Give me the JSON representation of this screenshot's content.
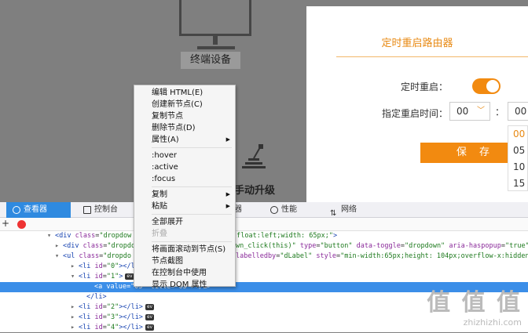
{
  "background": {
    "device_label": "终端设备",
    "upgrade_label": "手动升级"
  },
  "panel": {
    "title": "定时重启路由器",
    "reboot_label": "定时重启：",
    "time_label": "指定重启时间：",
    "hour_value": "00",
    "minute_value": "00",
    "colon": "：",
    "dropdown_options": [
      "00",
      "05",
      "10",
      "15"
    ],
    "save_label": "保 存",
    "accent_color": "#f28a10"
  },
  "context_menu": {
    "groups": [
      [
        {
          "label": "编辑 HTML(E)",
          "submenu": false,
          "disabled": false
        },
        {
          "label": "创建新节点(C)",
          "submenu": false,
          "disabled": false
        },
        {
          "label": "复制节点",
          "submenu": false,
          "disabled": false
        },
        {
          "label": "删除节点(D)",
          "submenu": false,
          "disabled": false
        },
        {
          "label": "属性(A)",
          "submenu": true,
          "disabled": false
        }
      ],
      [
        {
          "label": ":hover",
          "submenu": false,
          "disabled": false
        },
        {
          "label": ":active",
          "submenu": false,
          "disabled": false
        },
        {
          "label": ":focus",
          "submenu": false,
          "disabled": false
        }
      ],
      [
        {
          "label": "复制",
          "submenu": true,
          "disabled": false
        },
        {
          "label": "粘贴",
          "submenu": true,
          "disabled": false
        }
      ],
      [
        {
          "label": "全部展开",
          "submenu": false,
          "disabled": false
        },
        {
          "label": "折叠",
          "submenu": false,
          "disabled": true
        }
      ],
      [
        {
          "label": "将画面滚动到节点(S)",
          "submenu": false,
          "disabled": false
        },
        {
          "label": "节点截图",
          "submenu": false,
          "disabled": false
        },
        {
          "label": "在控制台中使用",
          "submenu": false,
          "disabled": false
        },
        {
          "label": "显示 DOM 属性",
          "submenu": false,
          "disabled": false
        }
      ]
    ]
  },
  "devtools": {
    "tabs": [
      {
        "label": "查看器",
        "active": true
      },
      {
        "label": "控制台",
        "active": false
      },
      {
        "label": "器",
        "active": false
      },
      {
        "label": "性能",
        "active": false
      },
      {
        "label": "网络",
        "active": false
      }
    ],
    "toolbar_plus": "+",
    "code_lines": [
      {
        "indent": 6,
        "tri": "▾",
        "html": "<span class=\"tag\">&lt;div</span> <span class=\"attr\">class</span>=<span class=\"val\">\"dropdow</span>",
        "tail": "<span class=\"val\">\"float:left;width: 65px;\"</span><span class=\"tag\">&gt;</span>",
        "tail_at": 296,
        "ev": false,
        "hl": false
      },
      {
        "indent": 7,
        "tri": "▸",
        "html": "<span class=\"tag\">&lt;div</span> <span class=\"attr\">class</span>=<span class=\"val\">\"dropdo</span>",
        "tail": "<span class=\"val\">wn_click(this)\"</span> <span class=\"attr\">type</span>=<span class=\"val\">\"button\"</span> <span class=\"attr\">data-toggle</span>=<span class=\"val\">\"dropdown\"</span> <span class=\"attr\">aria-haspopup</span>=<span class=\"val\">\"true\"</span> <span class=\"attr\">a</span>",
        "tail_at": 300,
        "ev": false,
        "hl": false
      },
      {
        "indent": 7,
        "tri": "▾",
        "html": "<span class=\"tag\">&lt;ul</span> <span class=\"attr\">class</span>=<span class=\"val\">\"dropdo</span>",
        "tail": "<span class=\"attr\">labelledby</span>=<span class=\"val\">\"dLabel\"</span> <span class=\"attr\">style</span>=<span class=\"val\">\"min-width:65px;height: 104px;overflow-x:hidden\"</span><span class=\"tag\">&gt;</span>",
        "tail_at": 300,
        "ev": false,
        "hl": false
      },
      {
        "indent": 9,
        "tri": "▸",
        "html": "<span class=\"tag\">&lt;li</span> <span class=\"attr\">id</span>=<span class=\"val\">\"0\"</span><span class=\"tag\">&gt;&lt;/li&gt;</span>",
        "tail": "",
        "tail_at": 0,
        "ev": true,
        "hl": false
      },
      {
        "indent": 9,
        "tri": "▾",
        "html": "<span class=\"tag\">&lt;li</span> <span class=\"attr\">id</span>=<span class=\"val\">\"1\"</span><span class=\"tag\">&gt;</span>",
        "tail": "",
        "tail_at": 0,
        "ev": true,
        "hl": false
      },
      {
        "indent": 11,
        "tri": "",
        "html": "<span class=\"tag\">&lt;a</span> <span class=\"attr\">value</span>=<span class=\"val\">\"05\"</span> <span class=\"attr\">title</span>=<span class=\"val\">\"05\"</span><span class=\"tag\">&gt;&lt;/a&gt;</span>",
        "tail": "",
        "tail_at": 0,
        "ev": false,
        "hl": true
      },
      {
        "indent": 10,
        "tri": "",
        "html": "<span class=\"tag\">&lt;/li&gt;</span>",
        "tail": "",
        "tail_at": 0,
        "ev": false,
        "hl": false
      },
      {
        "indent": 9,
        "tri": "▸",
        "html": "<span class=\"tag\">&lt;li</span> <span class=\"attr\">id</span>=<span class=\"val\">\"2\"</span><span class=\"tag\">&gt;&lt;/li&gt;</span>",
        "tail": "",
        "tail_at": 0,
        "ev": true,
        "hl": false
      },
      {
        "indent": 9,
        "tri": "▸",
        "html": "<span class=\"tag\">&lt;li</span> <span class=\"attr\">id</span>=<span class=\"val\">\"3\"</span><span class=\"tag\">&gt;&lt;/li&gt;</span>",
        "tail": "",
        "tail_at": 0,
        "ev": true,
        "hl": false
      },
      {
        "indent": 9,
        "tri": "▸",
        "html": "<span class=\"tag\">&lt;li</span> <span class=\"attr\">id</span>=<span class=\"val\">\"4\"</span><span class=\"tag\">&gt;&lt;/li&gt;</span>",
        "tail": "",
        "tail_at": 0,
        "ev": true,
        "hl": false
      }
    ],
    "event_badge": "ev"
  },
  "watermark": {
    "big": "值 值 值",
    "small": "zhizhizhi.com"
  }
}
